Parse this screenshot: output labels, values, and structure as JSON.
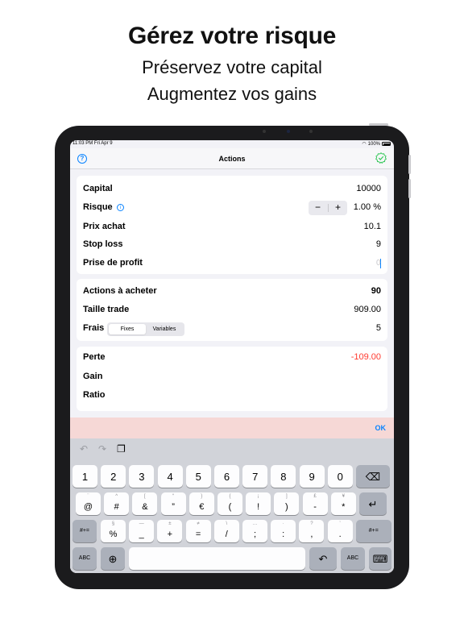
{
  "hero": {
    "title": "Gérez votre risque",
    "line1": "Préservez votre capital",
    "line2": "Augmentez vos gains"
  },
  "status": {
    "time": "11:03 PM   Fri Apr 9",
    "battery": "100%"
  },
  "navbar": {
    "title": "Actions",
    "help_icon": "question-circle-icon",
    "check_icon": "check-badge-icon"
  },
  "inputs": {
    "capital_label": "Capital",
    "capital_value": "10000",
    "risk_label": "Risque",
    "risk_value": "1.00 %",
    "stepper_minus": "−",
    "stepper_plus": "+",
    "buy_label": "Prix achat",
    "buy_value": "10.1",
    "stop_label": "Stop loss",
    "stop_value": "9",
    "target_label": "Prise de profit",
    "target_placeholder": "0"
  },
  "results": {
    "shares_label": "Actions à acheter",
    "shares_value": "90",
    "size_label": "Taille trade",
    "size_value": "909.00",
    "fees_label": "Frais",
    "fees_options": [
      "Fixes",
      "Variables"
    ],
    "fees_selected": "Fixes",
    "fees_value": "5"
  },
  "pnl": {
    "loss_label": "Perte",
    "loss_value": "-109.00",
    "gain_label": "Gain",
    "ratio_label": "Ratio"
  },
  "accessory": {
    "ok_label": "OK"
  },
  "keyboard": {
    "row1": [
      "1",
      "2",
      "3",
      "4",
      "5",
      "6",
      "7",
      "8",
      "9",
      "0"
    ],
    "row2": [
      {
        "main": "@",
        "alt": "¨"
      },
      {
        "main": "#",
        "alt": "^"
      },
      {
        "main": "&",
        "alt": "["
      },
      {
        "main": "”",
        "alt": "“"
      },
      {
        "main": "€",
        "alt": "}"
      },
      {
        "main": "(",
        "alt": "{"
      },
      {
        "main": "!",
        "alt": "¡"
      },
      {
        "main": ")",
        "alt": "]"
      },
      {
        "main": "-",
        "alt": "£"
      },
      {
        "main": "*",
        "alt": "¥"
      }
    ],
    "row3": [
      {
        "main": "%",
        "alt": "§"
      },
      {
        "main": "_",
        "alt": "—"
      },
      {
        "main": "+",
        "alt": "±"
      },
      {
        "main": "=",
        "alt": "≠"
      },
      {
        "main": "/",
        "alt": "\\"
      },
      {
        "main": ";",
        "alt": "…"
      },
      {
        "main": ":",
        "alt": "·"
      },
      {
        "main": ",",
        "alt": "?"
      },
      {
        "main": ".",
        "alt": "’"
      }
    ],
    "shift_label": "#+=",
    "abc_label": "ABC"
  }
}
